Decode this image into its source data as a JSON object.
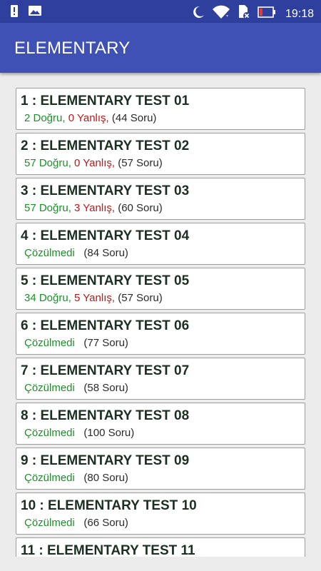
{
  "status_bar": {
    "time": "19:18",
    "icons": [
      "alert-icon",
      "image-icon",
      "moon-icon",
      "wifi-icon",
      "sim-card-icon",
      "battery-icon"
    ]
  },
  "app_bar": {
    "title": "ELEMENTARY"
  },
  "colors": {
    "status_bar": "#2f3f9e",
    "app_bar": "#3f51b5",
    "correct": "#1e8f2a",
    "wrong": "#c41616",
    "unsolved": "#1e8f2a"
  },
  "tests": [
    {
      "title": "1 : ELEMENTARY TEST 01",
      "solved": true,
      "correct": "2 Doğru,",
      "wrong": "0 Yanlış,",
      "unsolved": "",
      "questions": "(44 Soru)"
    },
    {
      "title": "2 : ELEMENTARY TEST 02",
      "solved": true,
      "correct": "57 Doğru,",
      "wrong": "0 Yanlış,",
      "unsolved": "",
      "questions": "(57 Soru)"
    },
    {
      "title": "3 : ELEMENTARY TEST 03",
      "solved": true,
      "correct": "57 Doğru,",
      "wrong": "3 Yanlış,",
      "unsolved": "",
      "questions": "(60 Soru)"
    },
    {
      "title": "4 : ELEMENTARY TEST 04",
      "solved": false,
      "correct": "",
      "wrong": "",
      "unsolved": "Çözülmedi",
      "questions": "(84 Soru)"
    },
    {
      "title": "5 : ELEMENTARY TEST 05",
      "solved": true,
      "correct": "34 Doğru,",
      "wrong": "5 Yanlış,",
      "unsolved": "",
      "questions": "(57 Soru)"
    },
    {
      "title": "6 : ELEMENTARY TEST 06",
      "solved": false,
      "correct": "",
      "wrong": "",
      "unsolved": "Çözülmedi",
      "questions": "(77 Soru)"
    },
    {
      "title": "7 : ELEMENTARY TEST 07",
      "solved": false,
      "correct": "",
      "wrong": "",
      "unsolved": "Çözülmedi",
      "questions": "(58 Soru)"
    },
    {
      "title": "8 : ELEMENTARY TEST 08",
      "solved": false,
      "correct": "",
      "wrong": "",
      "unsolved": "Çözülmedi",
      "questions": "(100 Soru)"
    },
    {
      "title": "9 : ELEMENTARY TEST 09",
      "solved": false,
      "correct": "",
      "wrong": "",
      "unsolved": "Çözülmedi",
      "questions": "(80 Soru)"
    },
    {
      "title": "10 : ELEMENTARY TEST 10",
      "solved": false,
      "correct": "",
      "wrong": "",
      "unsolved": "Çözülmedi",
      "questions": "(66 Soru)"
    },
    {
      "title": "11 : ELEMENTARY TEST 11",
      "solved": false,
      "correct": "",
      "wrong": "",
      "unsolved": "",
      "questions": ""
    }
  ]
}
